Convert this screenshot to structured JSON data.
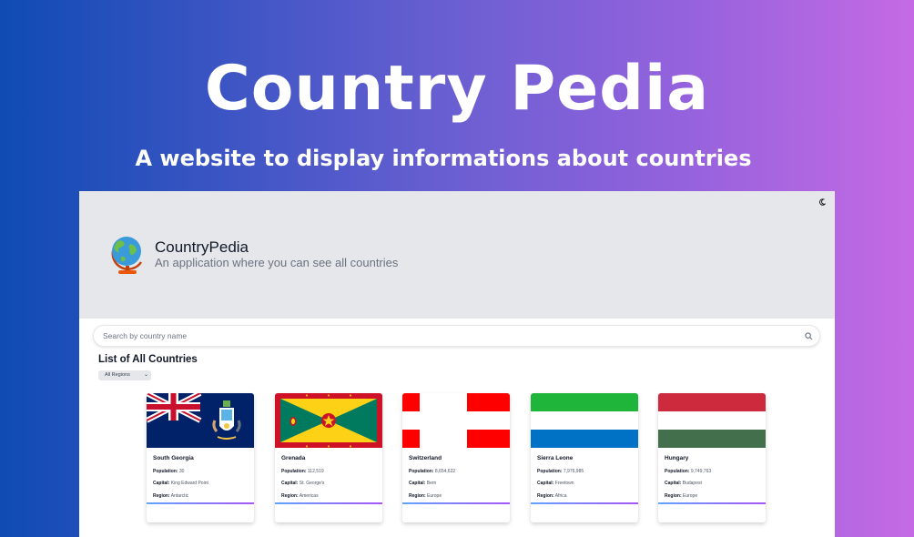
{
  "hero": {
    "title": "Country Pedia",
    "subtitle": "A website to display informations about countries"
  },
  "app": {
    "brand_name": "CountryPedia",
    "brand_tagline": "An application where you can see all countries",
    "search_placeholder": "Search by country name",
    "list_title": "List of All Countries",
    "region_filter": {
      "selected": "All Regions"
    },
    "labels": {
      "population": "Population:",
      "capital": "Capital:",
      "region": "Region:"
    },
    "icons": {
      "theme": "moon-icon",
      "search": "search-icon",
      "logo": "globe-icon"
    },
    "accent_gradient": [
      "#60a5fa",
      "#a855f7"
    ],
    "countries": [
      {
        "name": "South Georgia",
        "population": "30",
        "capital": "King Edward Point",
        "region": "Antarctic"
      },
      {
        "name": "Grenada",
        "population": "112,519",
        "capital": "St. George's",
        "region": "Americas"
      },
      {
        "name": "Switzerland",
        "population": "8,654,622",
        "capital": "Bern",
        "region": "Europe"
      },
      {
        "name": "Sierra Leone",
        "population": "7,976,985",
        "capital": "Freetown",
        "region": "Africa"
      },
      {
        "name": "Hungary",
        "population": "9,749,763",
        "capital": "Budapest",
        "region": "Europe"
      }
    ]
  }
}
